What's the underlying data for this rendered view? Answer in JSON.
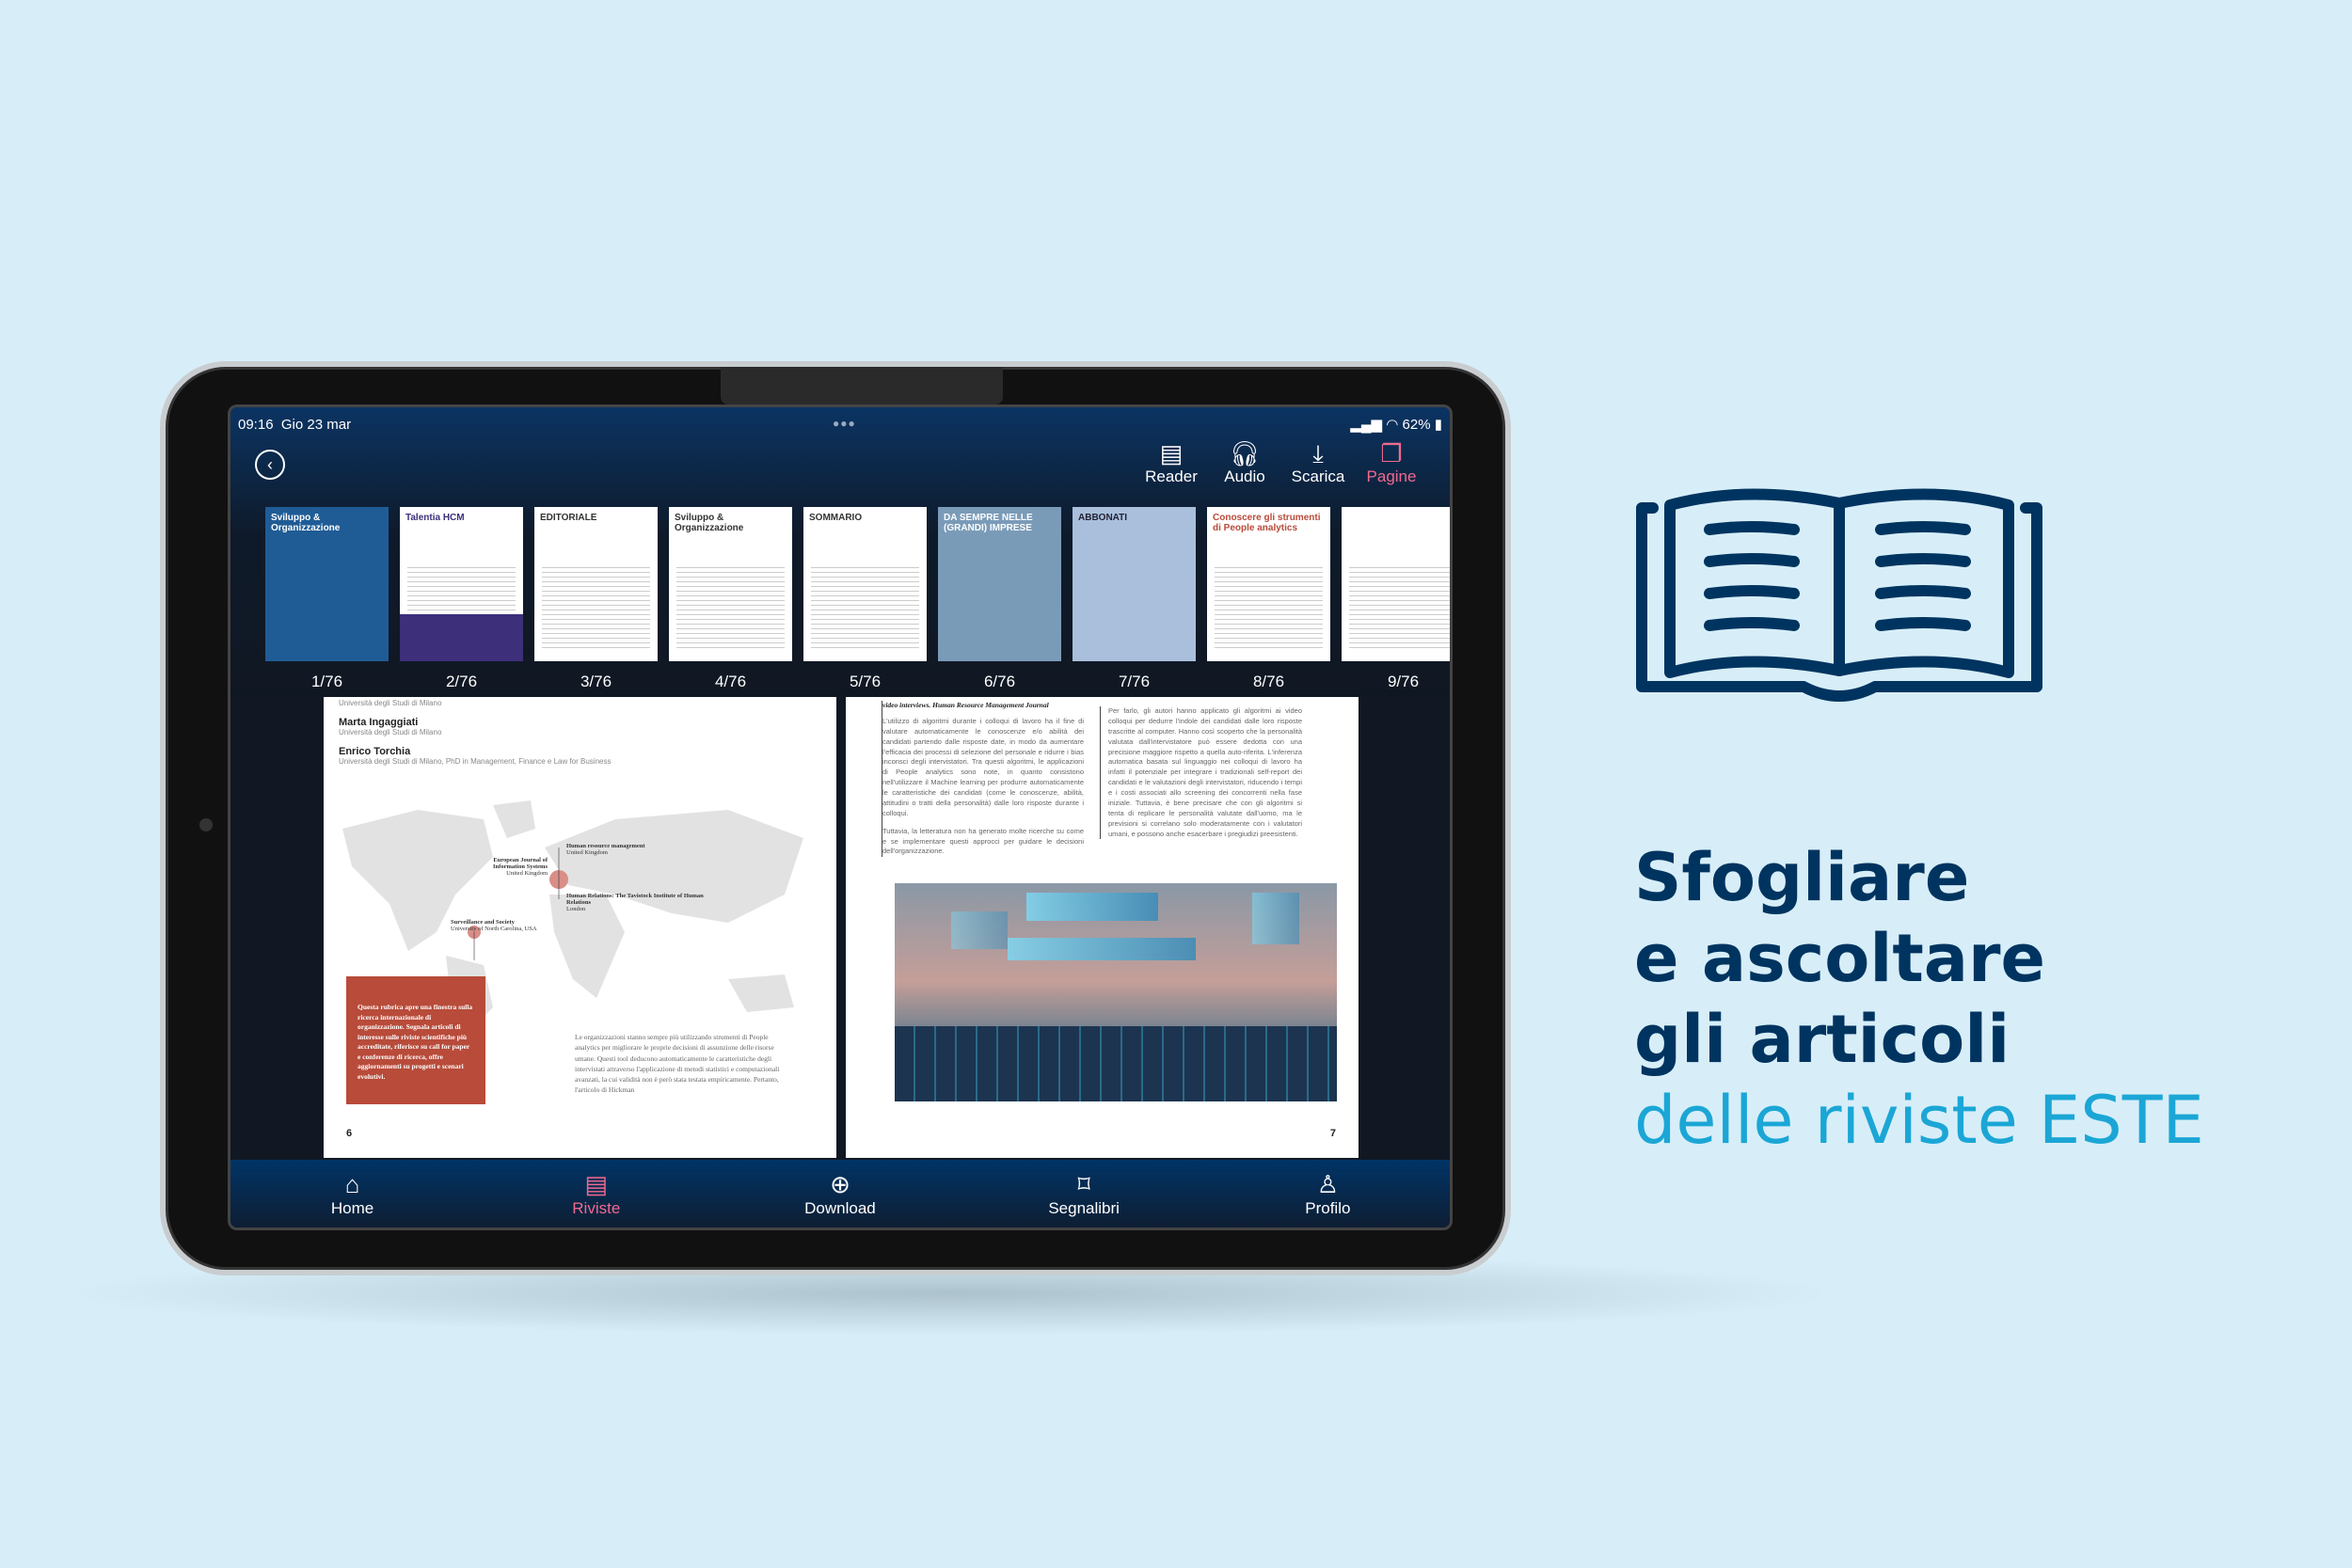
{
  "status": {
    "time": "09:16",
    "date": "Gio 23 mar",
    "battery": "62%"
  },
  "toolbar": {
    "back_icon": "chevron-left-icon",
    "items": [
      {
        "label": "Reader",
        "icon": "reader-icon"
      },
      {
        "label": "Audio",
        "icon": "headphones-icon"
      },
      {
        "label": "Scarica",
        "icon": "download-icon"
      },
      {
        "label": "Pagine",
        "icon": "pages-icon",
        "active": true
      }
    ]
  },
  "thumbnails": [
    {
      "label": "1/76",
      "title": "Sviluppo & Organizzazione"
    },
    {
      "label": "2/76",
      "title": "Talentia HCM"
    },
    {
      "label": "3/76",
      "title": "EDITORIALE"
    },
    {
      "label": "4/76",
      "title": "Sviluppo & Organizzazione"
    },
    {
      "label": "5/76",
      "title": "SOMMARIO"
    },
    {
      "label": "6/76",
      "title": "DA SEMPRE NELLE (GRANDI) IMPRESE"
    },
    {
      "label": "7/76",
      "title": "ABBONATI"
    },
    {
      "label": "8/76",
      "title": "Conoscere gli strumenti di People analytics"
    },
    {
      "label": "9/76",
      "title": ""
    }
  ],
  "left_page": {
    "affil0": "Università degli Studi di Milano",
    "author1": "Marta Ingaggiati",
    "affil1": "Università degli Studi di Milano",
    "author2": "Enrico Torchia",
    "affil2": "Università degli Studi di Milano, PhD in Management, Finance e Law for Business",
    "map_labels": [
      {
        "title": "Human resource management",
        "place": "United Kingdom"
      },
      {
        "title": "European Journal of Information Systems",
        "place": "United Kingdom"
      },
      {
        "title": "Human Relations: The Tavistock Institute of Human Relations",
        "place": "London"
      },
      {
        "title": "Surveillance and Society",
        "place": "University of North Carolina, USA"
      }
    ],
    "box_text": "Questa rubrica apre una finestra sulla ricerca internazionale di organizzazione. Segnala articoli di interesse sulle riviste scientifiche più accreditate, riferisce su call for paper e conferenze di ricerca, offre aggiornamenti su progetti e scenari evolutivi.",
    "body": "Le organizzazioni stanno sempre più utilizzando strumenti di People analytics per migliorare le proprie decisioni di assunzione delle risorse umane. Questi tool deducono automaticamente le caratteristiche degli intervistati attraverso l'applicazione di metodi statistici e computazionali avanzati, la cui validità non è però stata testata empiricamente. Pertanto, l'articolo di Hickman",
    "page_number": "6"
  },
  "right_page": {
    "col1_head": "video interviews. Human Resource Management Journal",
    "col1": "L'utilizzo di algoritmi durante i colloqui di lavoro ha il fine di valutare automaticamente le conoscenze e/o abilità dei candidati partendo dalle risposte date, in modo da aumentare l'efficacia dei processi di selezione del personale e ridurre i bias inconsci degli intervistatori. Tra questi algoritmi, le applicazioni di People analytics sono note, in quanto consistono nell'utilizzare il Machine learning per produrre automaticamente le caratteristiche dei candidati (come le conoscenze, abilità, attitudini o tratti della personalità) dalle loro risposte durante i colloqui.",
    "col1b": "Tuttavia, la letteratura non ha generato molte ricerche su come e se implementare questi approcci per guidare le decisioni dell'organizzazione.",
    "col2": "Per farlo, gli autori hanno applicato gli algoritmi ai video colloqui per dedurre l'indole dei candidati dalle loro risposte trascritte al computer. Hanno così scoperto che la personalità valutata dall'intervistatore può essere dedotta con una precisione maggiore rispetto a quella auto-riferita. L'inferenza automatica basata sul linguaggio nei colloqui di lavoro ha infatti il potenziale per integrare i tradizionali self-report dei candidati e le valutazioni degli intervistatori, riducendo i tempi e i costi associati allo screening dei concorrenti nella fase iniziale. Tuttavia, è bene precisare che con gli algoritmi si tenta di replicare le personalità valutate dall'uomo, ma le previsioni si correlano solo moderatamente con i valutatori umani, e possono anche esacerbare i pregiudizi preesistenti.",
    "page_number": "7"
  },
  "nav": [
    {
      "label": "Home",
      "icon": "home-icon"
    },
    {
      "label": "Riviste",
      "icon": "magazine-icon",
      "active": true
    },
    {
      "label": "Download",
      "icon": "download-circle-icon"
    },
    {
      "label": "Segnalibri",
      "icon": "bookmark-icon"
    },
    {
      "label": "Profilo",
      "icon": "profile-icon"
    }
  ],
  "promo": {
    "line1": "Sfogliare",
    "line2": "e ascoltare",
    "line3": "gli articoli",
    "line4": "delle riviste ESTE",
    "book_icon": "open-book-icon"
  },
  "colors": {
    "background": "#d7eef8",
    "navy": "#003460",
    "accent_pink": "#ef6a8f",
    "cyan": "#1ba6d6",
    "red_box": "#b84b3a"
  }
}
